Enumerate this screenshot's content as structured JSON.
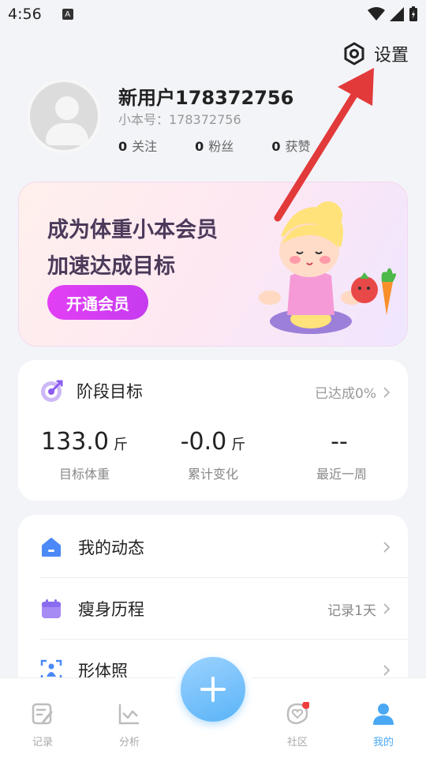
{
  "status_bar": {
    "time": "4:56",
    "notif_icon": "A"
  },
  "settings": {
    "label": "设置"
  },
  "profile": {
    "name": "新用户178372756",
    "id_label": "小本号：178372756",
    "stats": [
      {
        "value": "0",
        "label": "关注"
      },
      {
        "value": "0",
        "label": "粉丝"
      },
      {
        "value": "0",
        "label": "获赞"
      }
    ]
  },
  "vip": {
    "line1": "成为体重小本会员",
    "line2": "加速达成目标",
    "button": "开通会员"
  },
  "goal": {
    "title": "阶段目标",
    "progress": "已达成0%",
    "columns": [
      {
        "value": "133.0",
        "unit": "斤",
        "label": "目标体重"
      },
      {
        "value": "-0.0",
        "unit": "斤",
        "label": "累计变化"
      },
      {
        "value": "--",
        "unit": "",
        "label": "最近一周"
      }
    ]
  },
  "menu": [
    {
      "label": "我的动态",
      "right": ""
    },
    {
      "label": "瘦身历程",
      "right": "记录1天"
    },
    {
      "label": "形体照",
      "right": ""
    }
  ],
  "tabs": [
    {
      "label": "记录"
    },
    {
      "label": "分析"
    },
    {
      "label": "社区"
    },
    {
      "label": "我的"
    }
  ],
  "colors": {
    "accent": "#4aa8f5",
    "vip_button": "#d93ff3",
    "annotation_arrow": "#e23a3a"
  }
}
